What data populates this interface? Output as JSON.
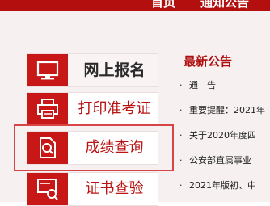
{
  "nav": {
    "home": "首页",
    "notice": "通知公告"
  },
  "menu": {
    "online_signup": "网上报名",
    "print_ticket": "打印准考证",
    "score_query": "成绩查询",
    "cert_check": "证书查验"
  },
  "news": {
    "title": "最新公告",
    "items": [
      "通　告",
      "重要提醒：2021年",
      "关于2020年度四",
      "公安部直属事业",
      "2021年版初、中"
    ]
  }
}
